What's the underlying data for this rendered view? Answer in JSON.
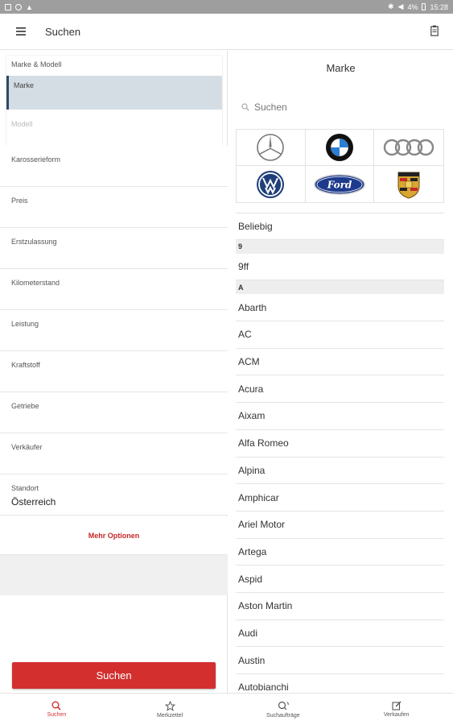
{
  "status_bar": {
    "battery": "4%",
    "time": "15:28"
  },
  "appbar": {
    "title": "Suchen"
  },
  "left": {
    "marke_modell_header": "Marke & Modell",
    "marke_label": "Marke",
    "modell_label": "Modell",
    "fields": [
      {
        "label": "Karosserieform",
        "value": ""
      },
      {
        "label": "Preis",
        "value": ""
      },
      {
        "label": "Erstzulassung",
        "value": ""
      },
      {
        "label": "Kilometerstand",
        "value": ""
      },
      {
        "label": "Leistung",
        "value": ""
      },
      {
        "label": "Kraftstoff",
        "value": ""
      },
      {
        "label": "Getriebe",
        "value": ""
      },
      {
        "label": "Verkäufer",
        "value": ""
      },
      {
        "label": "Standort",
        "value": "Österreich"
      }
    ],
    "mehr_optionen": "Mehr Optionen",
    "search_button": "Suchen"
  },
  "right": {
    "title": "Marke",
    "search_placeholder": "Suchen",
    "logos": [
      "mercedes-logo",
      "bmw-logo",
      "audi-logo",
      "volkswagen-logo",
      "ford-logo",
      "porsche-logo"
    ],
    "ford_text": "Ford",
    "any_label": "Beliebig",
    "section_9": "9",
    "brand_9ff": "9ff",
    "section_a": "A",
    "brands_a": [
      "Abarth",
      "AC",
      "ACM",
      "Acura",
      "Aixam",
      "Alfa Romeo",
      "Alpina",
      "Amphicar",
      "Ariel Motor",
      "Artega",
      "Aspid",
      "Aston Martin",
      "Audi",
      "Austin",
      "Autobianchi"
    ]
  },
  "bottom_nav": [
    {
      "label": "Suchen",
      "icon": "search-icon",
      "active": true
    },
    {
      "label": "Merkzettel",
      "icon": "star-icon",
      "active": false
    },
    {
      "label": "Suchaufträge",
      "icon": "saved-search-icon",
      "active": false
    },
    {
      "label": "Verkaufen",
      "icon": "edit-icon",
      "active": false
    }
  ],
  "colors": {
    "accent": "#d32f2f",
    "selected_bg": "#d5dde4",
    "status_bar": "#9e9e9e"
  }
}
